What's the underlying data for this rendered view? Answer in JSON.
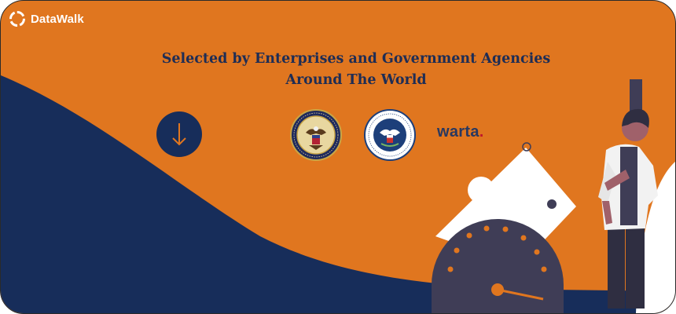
{
  "brand": {
    "name": "DataWalk"
  },
  "hero": {
    "headline_line1": "Selected by Enterprises and Government Agencies",
    "headline_line2": "Around The World",
    "scroll_icon": "arrow-down-icon"
  },
  "logos": [
    {
      "name": "U.S. Department of Justice seal",
      "icon": "doj-seal"
    },
    {
      "name": "U.S. Department of Homeland Security seal",
      "icon": "dhs-seal"
    },
    {
      "name": "warta",
      "text": "warta",
      "dot": "."
    }
  ],
  "colors": {
    "orange": "#e0761f",
    "navy": "#172d5a",
    "headline": "#1e2d55",
    "warta_dot": "#c0172b"
  }
}
